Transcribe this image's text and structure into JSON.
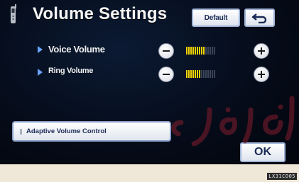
{
  "header": {
    "title": "Volume Settings",
    "default_label": "Default",
    "back_icon": "return-arrow-icon"
  },
  "voice": {
    "label": "Voice Volume",
    "level": 9,
    "max": 14
  },
  "ring": {
    "label": "Ring Volume",
    "level": 7,
    "max": 14
  },
  "adaptive": {
    "label": "Adaptive Volume Control"
  },
  "ok_label": "OK",
  "image_code": "LX31CO05",
  "colors": {
    "screen_bg": "#050b18",
    "meter_on": "#f2d400",
    "meter_off": "#3a4457",
    "bullet": "#6aa3ff",
    "button_text": "#1a2a55"
  }
}
